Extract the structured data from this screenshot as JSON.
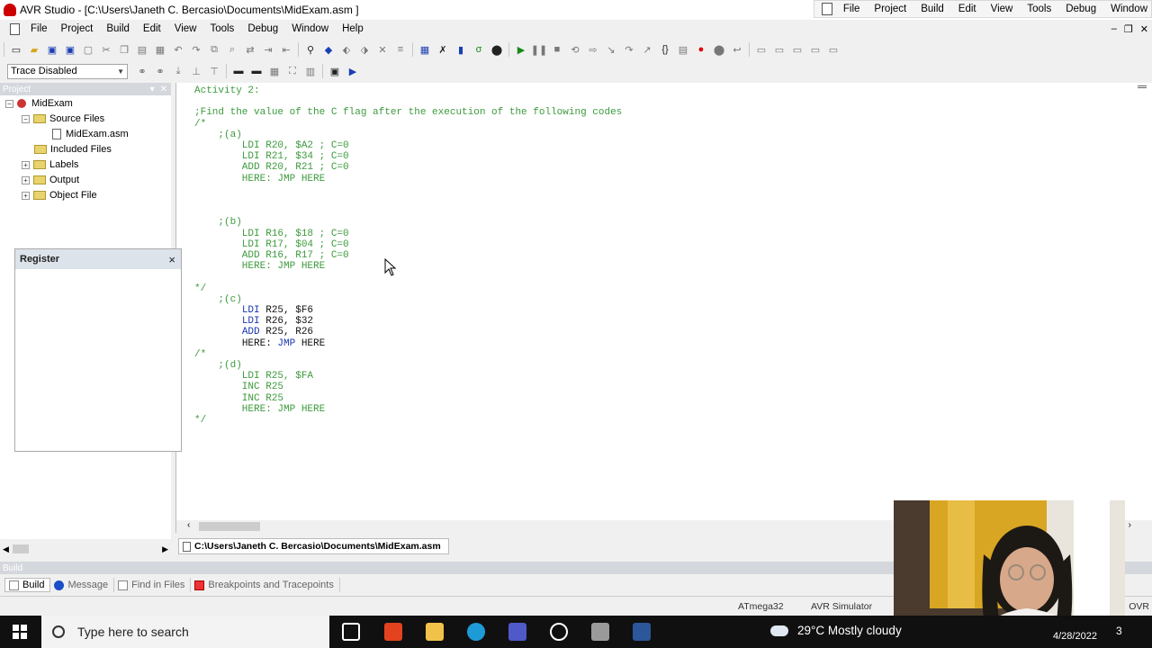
{
  "window": {
    "title": "AVR Studio - [C:\\Users\\Janeth C. Bercasio\\Documents\\MidExam.asm ]"
  },
  "host_menu": [
    "File",
    "Project",
    "Build",
    "Edit",
    "View",
    "Tools",
    "Debug",
    "Window"
  ],
  "menubar": [
    "File",
    "Project",
    "Build",
    "Edit",
    "View",
    "Tools",
    "Debug",
    "Window",
    "Help"
  ],
  "toolbar": {
    "trace_value": "Trace Disabled"
  },
  "project_panel": {
    "title": "Project",
    "root": "MidExam",
    "source_files": "Source Files",
    "source_file": "MidExam.asm",
    "included_files": "Included Files",
    "labels": "Labels",
    "output": "Output",
    "object_file": "Object File"
  },
  "register_panel": {
    "title": "Register",
    "close": "×"
  },
  "editor": {
    "lines": [
      {
        "t": "Activity 2:",
        "c": "green"
      },
      {
        "t": "",
        "c": "green"
      },
      {
        "t": ";Find the value of the C flag after the execution of the following codes",
        "c": "green"
      },
      {
        "t": "/*",
        "c": "green"
      },
      {
        "t": "    ;(a)",
        "c": "green"
      },
      {
        "t": "        LDI R20, $A2 ; C=0",
        "c": "green"
      },
      {
        "t": "        LDI R21, $34 ; C=0",
        "c": "green"
      },
      {
        "t": "        ADD R20, R21 ; C=0",
        "c": "green"
      },
      {
        "t": "        HERE: JMP HERE",
        "c": "green"
      },
      {
        "t": "",
        "c": "green"
      },
      {
        "t": "",
        "c": "green"
      },
      {
        "t": "",
        "c": "green"
      },
      {
        "t": "    ;(b)",
        "c": "green"
      },
      {
        "t": "        LDI R16, $18 ; C=0",
        "c": "green"
      },
      {
        "t": "        LDI R17, $04 ; C=0",
        "c": "green"
      },
      {
        "t": "        ADD R16, R17 ; C=0",
        "c": "green"
      },
      {
        "t": "        HERE: JMP HERE",
        "c": "green"
      },
      {
        "t": "",
        "c": "green"
      },
      {
        "t": "*/",
        "c": "green"
      },
      {
        "t": "    ;(c)",
        "c": "green"
      },
      {
        "t": "",
        "c": "code",
        "kw": "LDI",
        "rest": " R25, $F6"
      },
      {
        "t": "",
        "c": "code",
        "kw": "LDI",
        "rest": " R26, $32"
      },
      {
        "t": "",
        "c": "code",
        "kw": "ADD",
        "rest": " R25, R26"
      },
      {
        "t": "",
        "c": "code",
        "pre": "HERE: ",
        "kw": "JMP",
        "rest": " HERE"
      },
      {
        "t": "/*",
        "c": "green"
      },
      {
        "t": "    ;(d)",
        "c": "green"
      },
      {
        "t": "        LDI R25, $FA",
        "c": "green"
      },
      {
        "t": "        INC R25",
        "c": "green"
      },
      {
        "t": "        INC R25",
        "c": "green"
      },
      {
        "t": "        HERE: JMP HERE",
        "c": "green"
      },
      {
        "t": "*/",
        "c": "green"
      }
    ]
  },
  "doc_tab": "C:\\Users\\Janeth C. Bercasio\\Documents\\MidExam.asm",
  "build_panel": {
    "title": "Build",
    "tabs": [
      "Build",
      "Message",
      "Find in Files",
      "Breakpoints and Tracepoints"
    ]
  },
  "statusbar": {
    "device": "ATmega32",
    "platform": "AVR Simulator",
    "mode": "OVR"
  },
  "taskbar": {
    "search_placeholder": "Type here to search",
    "weather": "29°C  Mostly cloudy",
    "date": "4/28/2022",
    "notifications": "3"
  },
  "colors": {
    "comment_green": "#3d9a3d",
    "keyword_blue": "#1a35b0",
    "panel_header": "#d4d8dd"
  }
}
